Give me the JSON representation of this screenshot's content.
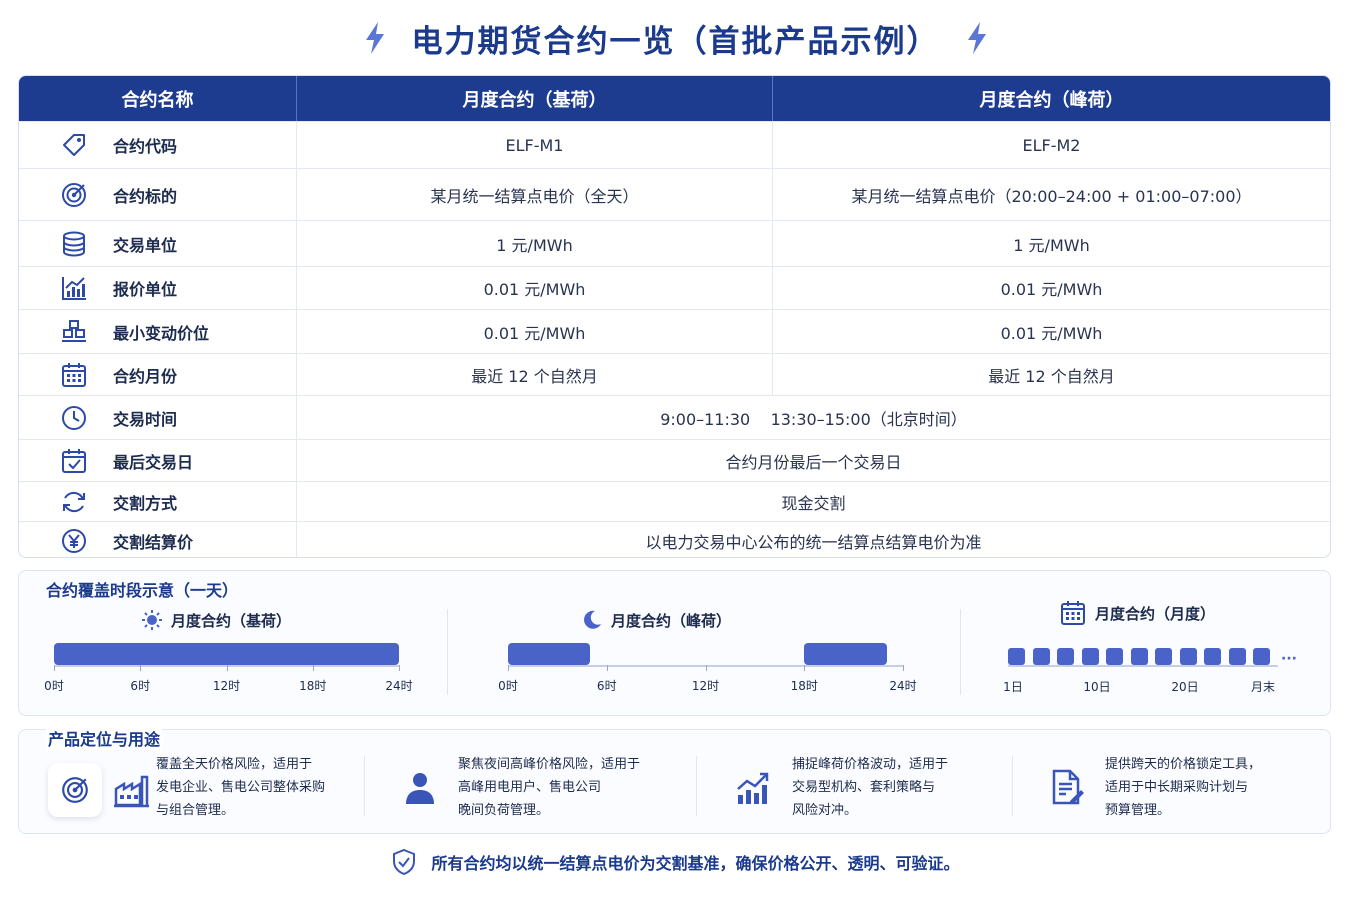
{
  "title": "电力期货合约一览（首批产品示例）",
  "colors": {
    "navy": "#1d3b8f",
    "accent": "#4a63c8",
    "title": "#1b3a8c"
  },
  "table": {
    "headers": [
      "合约名称",
      "月度合约（基荷）",
      "月度合约（峰荷）"
    ],
    "rows": [
      {
        "icon": "tag-icon",
        "label": "合约代码",
        "base": "ELF-M1",
        "peak": "ELF-M2"
      },
      {
        "icon": "target-icon",
        "label": "合约标的",
        "base": "某月统一结算点电价（全天）",
        "peak": "某月统一结算点电价（20:00–24:00 + 01:00–07:00）"
      },
      {
        "icon": "database-icon",
        "label": "交易单位",
        "base": "1 元/MWh",
        "peak": "1 元/MWh"
      },
      {
        "icon": "bar-chart-icon",
        "label": "报价单位",
        "base": "0.01 元/MWh",
        "peak": "0.01 元/MWh"
      },
      {
        "icon": "steps-icon",
        "label": "最小变动价位",
        "base": "0.01 元/MWh",
        "peak": "0.01 元/MWh"
      },
      {
        "icon": "calendar-icon",
        "label": "合约月份",
        "base": "最近 12 个自然月",
        "peak": "最近 12 个自然月"
      }
    ],
    "span_rows": [
      {
        "icon": "clock-icon",
        "label": "交易时间",
        "value": "9:00–11:30    13:30–15:00（北京时间）"
      },
      {
        "icon": "calendar-check-icon",
        "label": "最后交易日",
        "value": "合约月份最后一个交易日"
      },
      {
        "icon": "refresh-icon",
        "label": "交割方式",
        "value": "现金交割"
      },
      {
        "icon": "yen-icon",
        "label": "交割结算价",
        "value": "以电力交易中心公布的统一结算点结算电价为准"
      }
    ]
  },
  "timeline": {
    "title": "合约覆盖时段示意（一天）",
    "base": {
      "label": "月度合约（基荷）",
      "ticks": [
        "0时",
        "6时",
        "12时",
        "18时",
        "24时"
      ],
      "segments": [
        [
          0,
          24
        ]
      ]
    },
    "peak": {
      "label": "月度合约（峰荷）",
      "ticks": [
        "0时",
        "6时",
        "12时",
        "18时",
        "24时"
      ],
      "segments": [
        [
          0,
          5
        ],
        [
          18,
          23
        ]
      ]
    },
    "monthly": {
      "label": "月度合约（月度）",
      "ticks": [
        "1日",
        "10日",
        "20日",
        "月末"
      ],
      "blocks": 11,
      "ellipsis": "···"
    }
  },
  "usage": {
    "title": "产品定位与用途",
    "items": [
      {
        "icon": "factory-icon",
        "text": [
          "覆盖全天价格风险，适用于",
          "发电企业、售电公司整体采购",
          "与组合管理。"
        ]
      },
      {
        "icon": "user-icon",
        "text": [
          "聚焦夜间高峰价格风险，适用于",
          "高峰用电用户、售电公司",
          "晚间负荷管理。"
        ]
      },
      {
        "icon": "growth-chart-icon",
        "text": [
          "捕捉峰荷价格波动，适用于",
          "交易型机构、套利策略与",
          "风险对冲。"
        ]
      },
      {
        "icon": "document-edit-icon",
        "text": [
          "提供跨天的价格锁定工具，",
          "适用于中长期采购计划与",
          "预算管理。"
        ]
      }
    ]
  },
  "footer": "所有合约均以统一结算点电价为交割基准，确保价格公开、透明、可验证。"
}
